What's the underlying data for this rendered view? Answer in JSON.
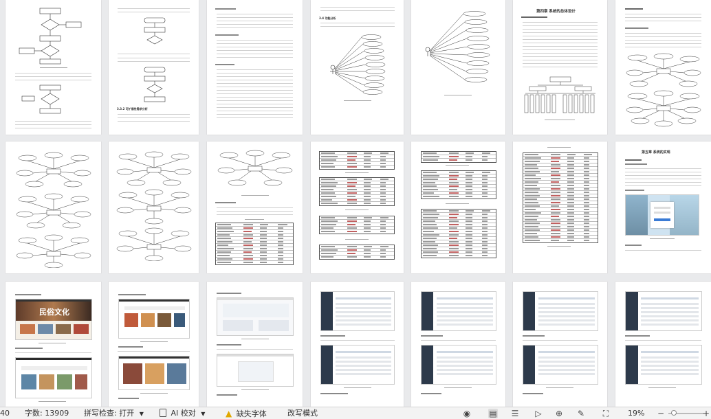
{
  "status_bar": {
    "page_number": "40",
    "word_count": "字数: 13909",
    "spell_check": "拼写检查: 打开",
    "ai_check": "AI 校对",
    "missing_font": "缺失字体",
    "overwrite_mode": "改写模式",
    "zoom": "19%",
    "missing_font_color": "#e0a800",
    "accent": "#1a73e8"
  },
  "pages": {
    "p5_title": "第四章 系统的总体设计",
    "p12_title": "第五章 系统的实现",
    "p4_subtitle": "3.4 功能分析",
    "p2_subtitle": "3.3.2 可扩展性需求分析",
    "p13_photo_text": "民俗文化"
  },
  "icons": {
    "dropdown": "chevron-down-icon",
    "ai": "ai-document-icon",
    "warning": "warning-icon",
    "eye": "eye-icon",
    "page_view": "page-view-icon",
    "outline": "outline-icon",
    "play": "play-icon",
    "web": "globe-icon",
    "pen": "pen-icon",
    "fit": "fit-page-icon",
    "zoom_out": "zoom-out-icon",
    "zoom_in": "zoom-in-icon"
  }
}
